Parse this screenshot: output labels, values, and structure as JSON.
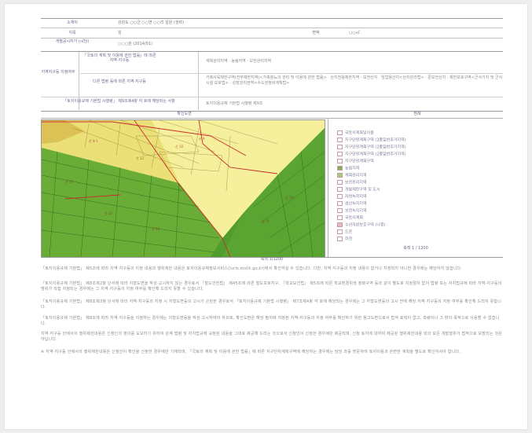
{
  "header": {
    "row1_label": "소재지",
    "row1_value": "강원도 ○○군 ○○면 ○○리 일원 (생략)",
    "row2_label": "지목",
    "row2_value": "임",
    "row2_label_b": "면적",
    "row2_value_b": "○○㎡",
    "row3_label": "개별공시지가 (㎡당)",
    "row3_value": "○○○원 (2014/01)"
  },
  "zoning": {
    "left_label": "지역지구등 지정여부",
    "a_label": "「국토의 계획 및 이용에 관한 법률」에 따른 지역·지구등",
    "a_value": "계획관리지역 · 농림지역 · 보전관리지역",
    "b_label": "다른 법령 등에 따른 지역·지구등",
    "b_value": "가축사육제한구역(전부제한지역)<가축분뇨의 관리 및 이용에 관한 법률> · 산지전용제한지역 · 보전산지 · 임업용산지<산지관리법> · 준보전산지 · 제한보호구역<군사기지 및 군사시설 보호법> · 성장관리권역<수도권정비계획법>",
    "c_value": "토지이용규제 기본법 시행령 제9조",
    "c_label": "「토지이용규제 기본법 시행령」 제9조제4항 각 호에 해당되는 사항"
  },
  "map": {
    "title": "확인도면",
    "legend_title": "범례",
    "caption": "축척 1/1200",
    "scale": "축척 1 / 1200",
    "legend": [
      {
        "label": "국토의계획및이용",
        "color": "#ffffff"
      },
      {
        "label": "지구단위계획구역 (2종일반주거지역)",
        "color": "#ffffff"
      },
      {
        "label": "지구단위계획구역 (2종일반주거지역)",
        "color": "#ffffff"
      },
      {
        "label": "지구단위계획구역 (2종일반주거지역)",
        "color": "#ffffff"
      },
      {
        "label": "지구단위계획구역",
        "color": "#ffffff"
      },
      {
        "label": "농림지역",
        "color": "#7fb24b"
      },
      {
        "label": "계획관리지역",
        "color": "#a4d067"
      },
      {
        "label": "보전관리지역",
        "color": "#ffffff"
      },
      {
        "label": "개발제한구역 및 도시",
        "color": "#ffffff"
      },
      {
        "label": "자연녹지지역",
        "color": "#ffffff"
      },
      {
        "label": "생산녹지지역",
        "color": "#ffffff"
      },
      {
        "label": "보전녹지지역",
        "color": "#ffffff"
      },
      {
        "label": "국토의계획",
        "color": "#ffffff"
      },
      {
        "label": "수산자원보호구역 (나중)",
        "color": "#e5b8c4"
      },
      {
        "label": "도로",
        "color": "#ffffff"
      },
      {
        "label": "하천",
        "color": "#ffffff"
      }
    ]
  },
  "notes": [
    "「토지이용규제 기본법」 제5조에 따라 지역·지구등의 지정 내용과 행위제한 내용은 토지이용규제정보서비스(luris.molit.go.kr)에서 확인하실 수 있습니다. 다만, 지역·지구등의 지정 내용이 없거나 지정되지 아니한 경우에는 해당하지 않습니다.",
    "「토지이용규제 기본법」 제8조제2항 단서에 따라 지형도면을 작성·고시하지 않는 경우로서 「철도안전법」 제45조에 따른 철도보호지구, 「학교보건법」 제5조에 따른 학교환경위생 정화구역 등과 같이 별도로 지정절차 없이 법령 또는 자치법규에 따라 지역·지구등의 범위가 직접 지정되는 경우에는 그 지역·지구등의 지정 여부를 확인해 드리지 못할 수 있습니다.",
    "「토지이용규제 기본법」 제8조제3항 단서에 따라 지역·지구등의 지정 시 지형도면등의 고시가 곤란한 경우로서 「토지이용규제 기본법 시행령」 제7조제4항 각 호에 해당되는 경우에는 그 지형도면등의 고시 전에 해당 지역·지구등의 지정 여부를 확인해 드리지 못합니다.",
    "「토지이용규제 기본법」 제8조에 따라 지역·지구등을 지정하는 경우에는 지형도면등을 작성·고시하여야 하므로, 확인도면은 해당 필지에 지정된 지역·지구등의 지정 여부를 확인하기 위한 참고도면으로서 법적 효력이 없고, 측량이나 그 밖의 목적으로 사용할 수 없습니다.",
    "지역·지구등 안에서의 행위제한내용은 신청인의 편의를 도모하기 위하여 관계 법령 및 자치법규에 규정된 내용을 그대로 제공해 드리는 것으로서 신청인이 신청한 경우에만 제공되며, 신청 토지에 대하여 제공된 행위제한내용 외의 모든 개발행위가 법적으로 보장되는 것은 아닙니다.",
    "※ 지역·지구등 안에서의 행위제한내용은 신청인이 확인을 신청한 경우에만 기재되며, 「국토의 계획 및 이용에 관한 법률」에 따른 지구단위계획구역에 해당하는 경우에는 담당 과를 방문하여 토지이용과 관련한 계획을 별도로 확인하셔야 합니다."
  ]
}
